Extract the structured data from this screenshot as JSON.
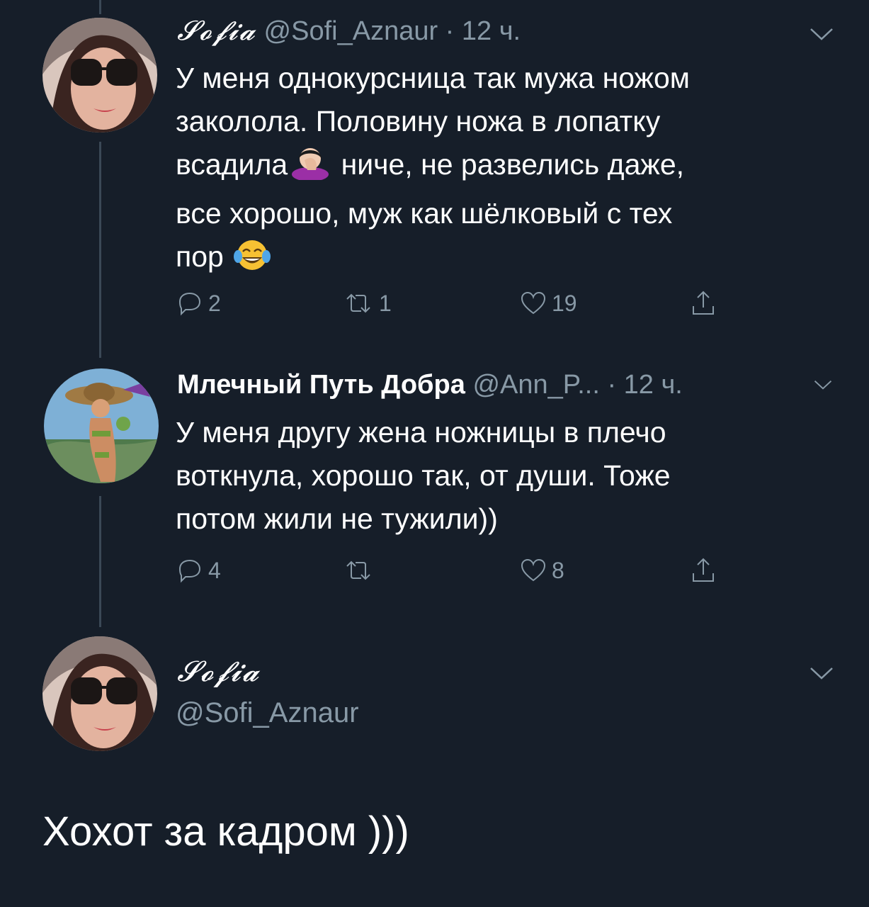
{
  "tweet1": {
    "display_name": "𝓢𝓸𝓯𝓲𝓪",
    "handle": "@Sofi_Aznaur",
    "separator": " · ",
    "time": "12 ч.",
    "lines": [
      "У меня однокурсница так мужа ножом",
      "заколола. Половину ножа в лопатку",
      "всадила",
      " ниче, не развелись даже,",
      "все хорошо, муж как шёлковый с тех",
      "пор"
    ],
    "emoji_1": "facepalm-emoji",
    "emoji_2": "tears-of-joy-emoji",
    "actions": {
      "reply_count": "2",
      "retweet_count": "1",
      "like_count": "19"
    }
  },
  "tweet2": {
    "display_name": "Млечный Путь Добра",
    "handle": "@Ann_P...",
    "separator": " · ",
    "time": "12 ч.",
    "lines": [
      "У меня другу жена ножницы в плечо",
      "воткнула, хорошо так, от души. Тоже",
      "потом жили не тужили))"
    ],
    "actions": {
      "reply_count": "4",
      "retweet_count": "",
      "like_count": "8"
    }
  },
  "main_tweet": {
    "display_name": "𝓢𝓸𝓯𝓲𝓪",
    "handle": "@Sofi_Aznaur",
    "text": "Хохот за кадром )))"
  },
  "colors": {
    "background": "#161e29",
    "text": "#ffffff",
    "muted": "#8899a6",
    "thread_line": "#3b4856"
  }
}
